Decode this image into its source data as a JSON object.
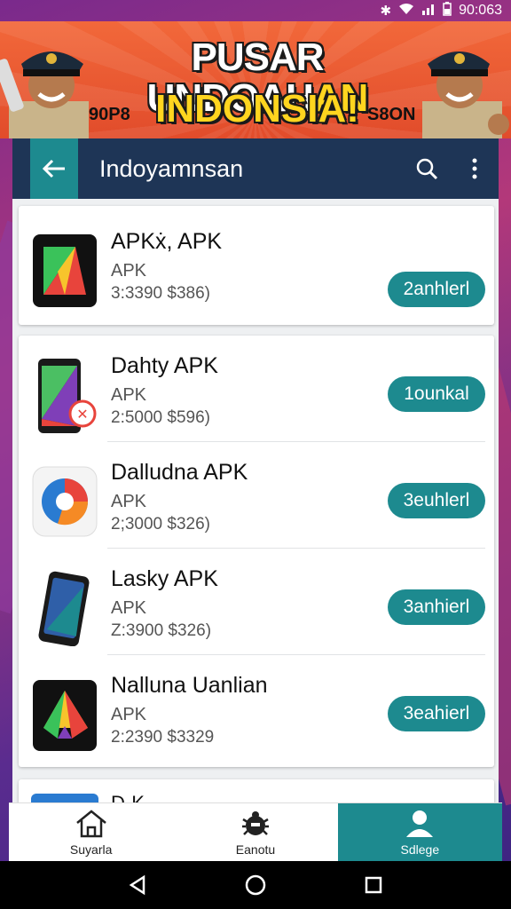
{
  "status_bar": {
    "time": "90:063"
  },
  "banner": {
    "title_main": "PUSAR UNDOAH",
    "title_accent": "AN",
    "subtitle": "INDONSIA!",
    "tag_left": "90P8",
    "tag_right": "S8ON"
  },
  "app_bar": {
    "title": "Indoyamnsan"
  },
  "apps": [
    {
      "name": "APKẋ, APK",
      "type": "APK",
      "meta": "3:3390  $386)",
      "button": "2anhlerl"
    },
    {
      "name": "Dahty APK",
      "type": "APK",
      "meta": "2:5000  $596)",
      "button": "1ounkal"
    },
    {
      "name": "Dalludna APK",
      "type": "APK",
      "meta": "2;3000  $326)",
      "button": "3euhlerl"
    },
    {
      "name": "Lasky APK",
      "type": "APK",
      "meta": "Z:3900  $326)",
      "button": "3anhierl"
    },
    {
      "name": "Nalluna Uanlian",
      "type": "APK",
      "meta": "2:2390  $3329",
      "button": "3eahierl"
    }
  ],
  "peek_item": {
    "name": "D-K"
  },
  "bottom_nav": [
    {
      "label": "Suyarla",
      "icon": "home-icon"
    },
    {
      "label": "Eanotu",
      "icon": "bug-icon"
    },
    {
      "label": "Sdlege",
      "icon": "profile-icon"
    }
  ],
  "colors": {
    "accent": "#1d8a8f",
    "app_bar": "#1e3556",
    "banner": "#e85a30"
  }
}
